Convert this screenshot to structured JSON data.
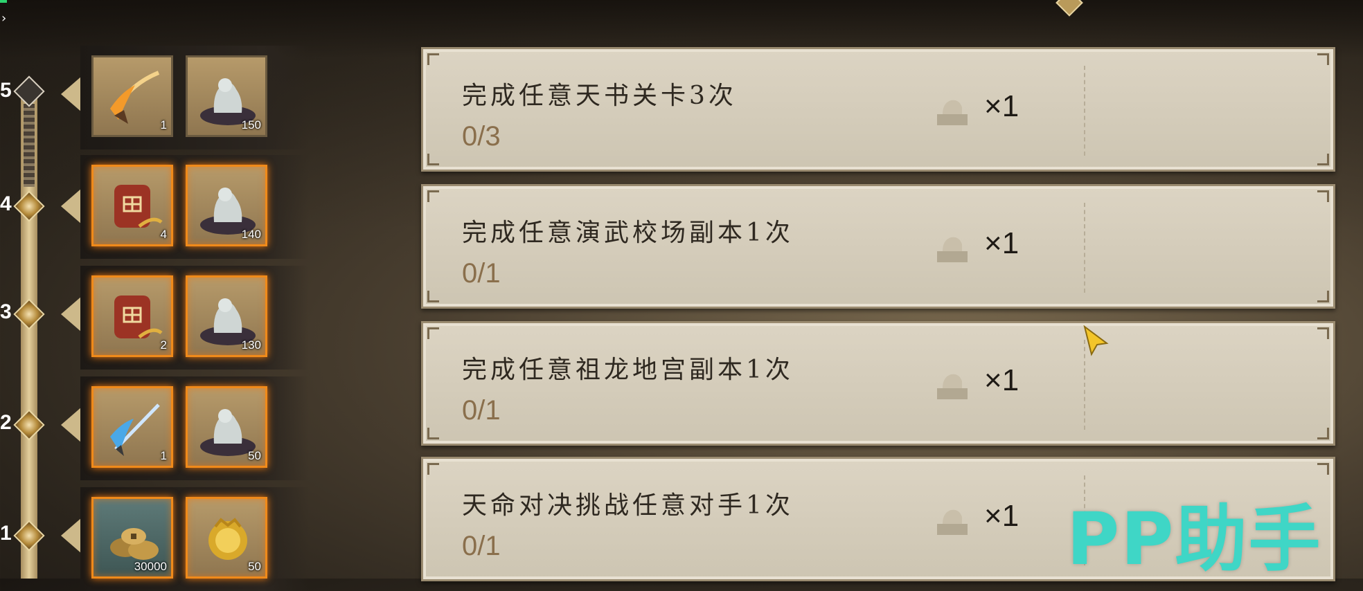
{
  "levels": [
    {
      "number": "5",
      "rewards": [
        {
          "icon": "flaming-spear-icon",
          "qty": "1"
        },
        {
          "icon": "jade-lion-icon",
          "qty": "150"
        }
      ]
    },
    {
      "number": "4",
      "rewards": [
        {
          "icon": "seed-bag-icon",
          "qty": "4"
        },
        {
          "icon": "jade-lion-icon",
          "qty": "140"
        }
      ]
    },
    {
      "number": "3",
      "rewards": [
        {
          "icon": "seed-bag-icon",
          "qty": "2"
        },
        {
          "icon": "jade-lion-icon",
          "qty": "130"
        }
      ]
    },
    {
      "number": "2",
      "rewards": [
        {
          "icon": "ice-spear-icon",
          "qty": "1"
        },
        {
          "icon": "jade-lion-icon",
          "qty": "50"
        }
      ]
    },
    {
      "number": "1",
      "rewards": [
        {
          "icon": "coin-pile-icon",
          "qty": "30000"
        },
        {
          "icon": "gold-medal-icon",
          "qty": "50"
        }
      ]
    }
  ],
  "tasks": [
    {
      "title": "完成任意天书关卡3次",
      "progress": "0/3",
      "reward_icon": "lion-seal-icon",
      "reward_qty": "×1"
    },
    {
      "title": "完成任意演武校场副本1次",
      "progress": "0/1",
      "reward_icon": "lion-seal-icon",
      "reward_qty": "×1"
    },
    {
      "title": "完成任意祖龙地宫副本1次",
      "progress": "0/1",
      "reward_icon": "lion-seal-icon",
      "reward_qty": "×1"
    },
    {
      "title": "天命对决挑战任意对手1次",
      "progress": "0/1",
      "reward_icon": "lion-seal-icon",
      "reward_qty": "×1"
    }
  ],
  "watermark": "PP助手",
  "colors": {
    "accent_orange": "#f08a1a",
    "watermark": "#3fd6c6",
    "progress_text": "#8a6f4c"
  }
}
